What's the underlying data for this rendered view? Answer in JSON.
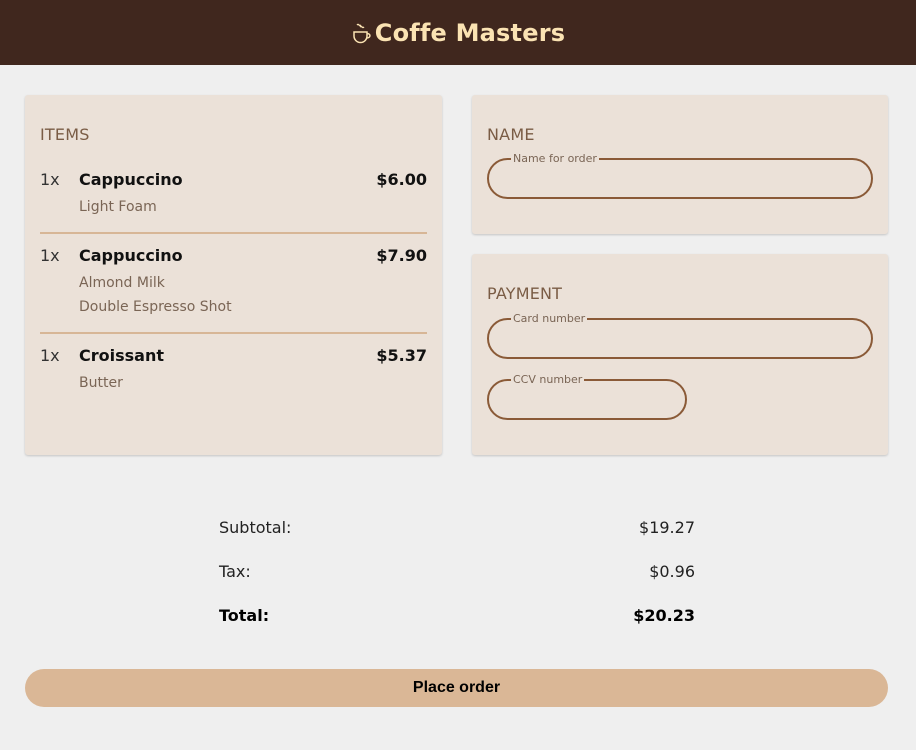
{
  "header": {
    "title": "Coffe Masters",
    "logo_icon": "coffee-cup-icon"
  },
  "items": {
    "title": "ITEMS",
    "list": [
      {
        "qty": "1x",
        "name": "Cappuccino",
        "price": "$6.00",
        "options": [
          "Light Foam"
        ]
      },
      {
        "qty": "1x",
        "name": "Cappuccino",
        "price": "$7.90",
        "options": [
          "Almond Milk",
          "Double Espresso Shot"
        ]
      },
      {
        "qty": "1x",
        "name": "Croissant",
        "price": "$5.37",
        "options": [
          "Butter"
        ]
      }
    ]
  },
  "name_section": {
    "title": "NAME",
    "name_field_label": "Name for order",
    "name_value": ""
  },
  "payment": {
    "title": "PAYMENT",
    "card_label": "Card number",
    "card_value": "",
    "ccv_label": "CCV number",
    "ccv_value": ""
  },
  "totals": {
    "subtotal_label": "Subtotal:",
    "subtotal_value": "$19.27",
    "tax_label": "Tax:",
    "tax_value": "$0.96",
    "total_label": "Total:",
    "total_value": "$20.23"
  },
  "actions": {
    "place_order_label": "Place order"
  },
  "colors": {
    "header_bg": "#40271e",
    "brand_text": "#fbe3b3",
    "card_bg": "#ebe1d8",
    "button_bg": "#dab796",
    "field_border": "#8a5a37"
  }
}
